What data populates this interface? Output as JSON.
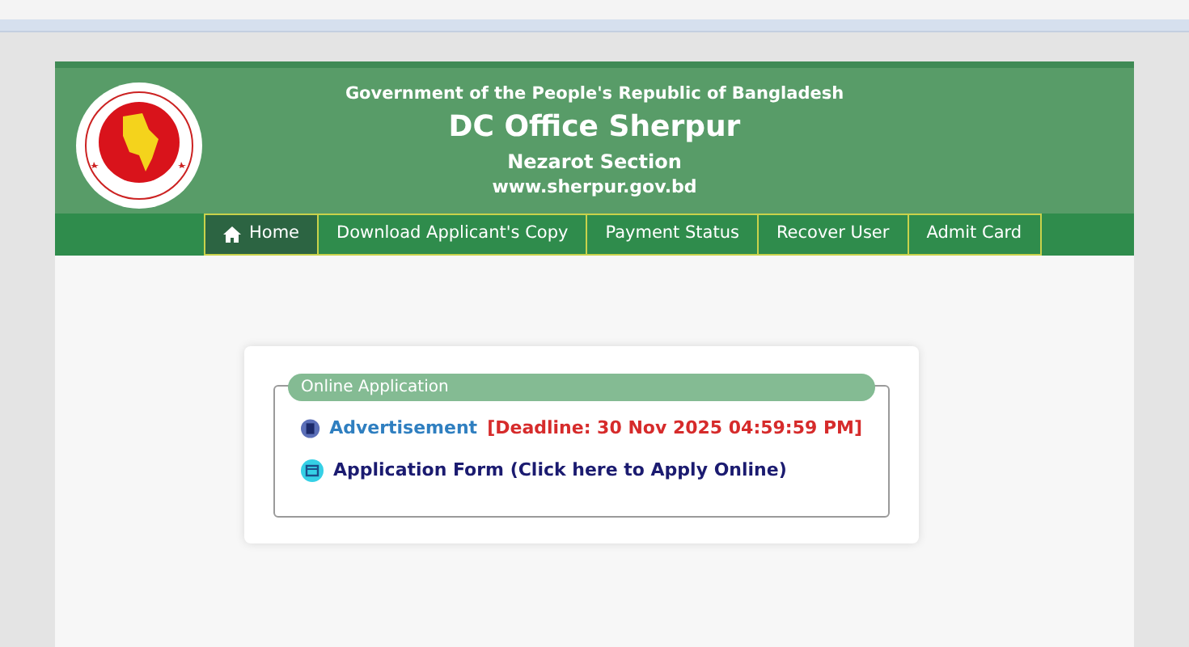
{
  "header": {
    "government": "Government of the People's Republic of Bangladesh",
    "office": "DC Office Sherpur",
    "section": "Nezarot Section",
    "website": "www.sherpur.gov.bd"
  },
  "nav": [
    {
      "label": "Home",
      "kind": "home",
      "selected": true
    },
    {
      "label": "Download Applicant's Copy",
      "selected": false
    },
    {
      "label": "Payment Status",
      "selected": false
    },
    {
      "label": "Recover User",
      "selected": false
    },
    {
      "label": "Admit Card",
      "selected": false
    }
  ],
  "panel": {
    "legend": "Online Application",
    "items": [
      {
        "kind": "pdf",
        "label": "Advertisement",
        "note": "[Deadline: 30 Nov 2025 04:59:59 PM]"
      },
      {
        "kind": "form",
        "label": "Application Form (Click here to Apply Online)"
      }
    ]
  }
}
